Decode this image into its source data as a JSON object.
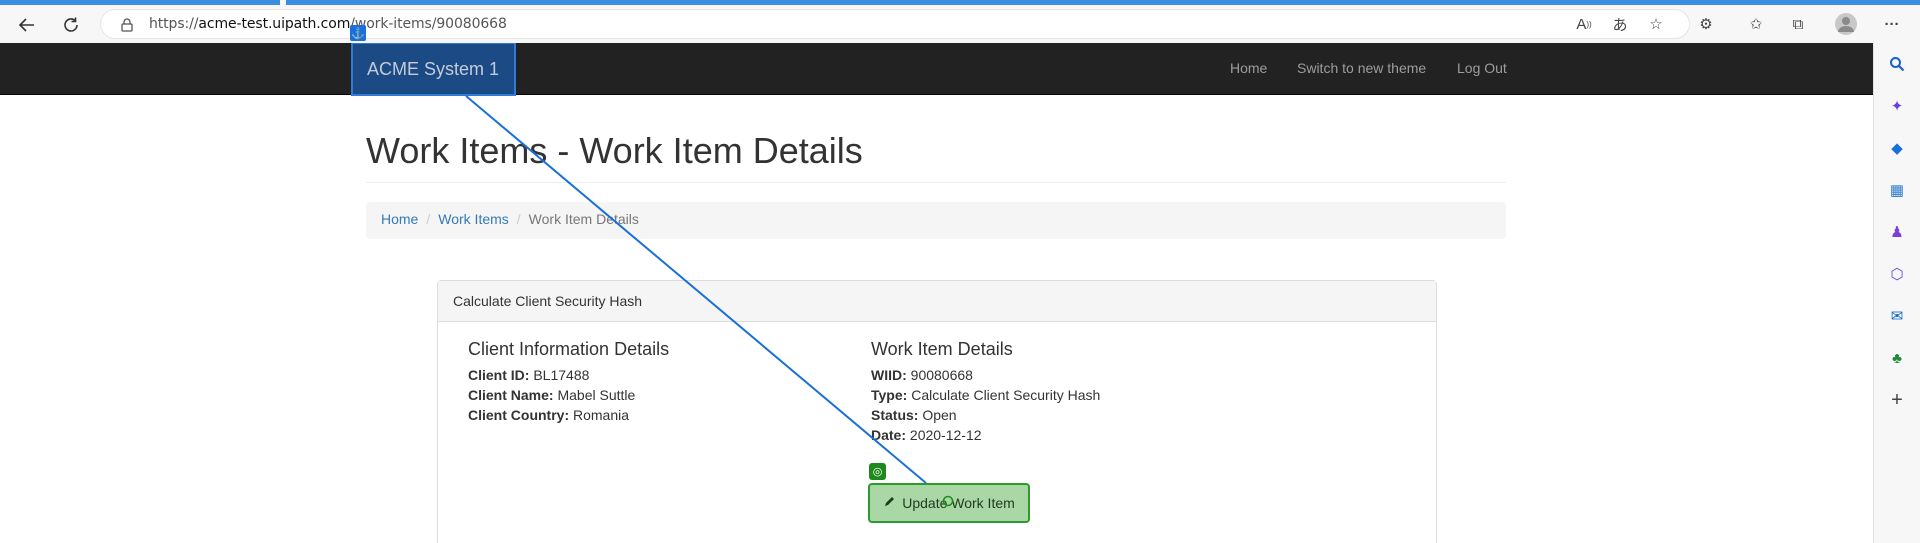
{
  "browser": {
    "url_prefix": "https://",
    "url_host": "acme-test.uipath.com",
    "url_path": "/work-items/90080668"
  },
  "navbar": {
    "brand": "ACME System 1",
    "links": [
      "Home",
      "Switch to new theme",
      "Log Out"
    ]
  },
  "page": {
    "title": "Work Items - Work Item Details",
    "breadcrumb": [
      "Home",
      "Work Items",
      "Work Item Details"
    ]
  },
  "panel": {
    "heading": "Calculate Client Security Hash",
    "client": {
      "title": "Client Information Details",
      "fields": [
        {
          "label": "Client ID:",
          "value": "BL17488"
        },
        {
          "label": "Client Name:",
          "value": "Mabel Suttle"
        },
        {
          "label": "Client Country:",
          "value": "Romania"
        }
      ]
    },
    "work_item": {
      "title": "Work Item Details",
      "fields": [
        {
          "label": "WIID:",
          "value": "90080668"
        },
        {
          "label": "Type:",
          "value": "Calculate Client Security Hash"
        },
        {
          "label": "Status:",
          "value": "Open"
        },
        {
          "label": "Date:",
          "value": "2020-12-12"
        }
      ]
    },
    "update_button": "Update Work Item"
  },
  "colors": {
    "navbar": "#222222",
    "brand_highlight": "#1c4a85",
    "link": "#337ab7",
    "button_highlight": "#a9d7a5",
    "connector": "#1a6fd8"
  }
}
